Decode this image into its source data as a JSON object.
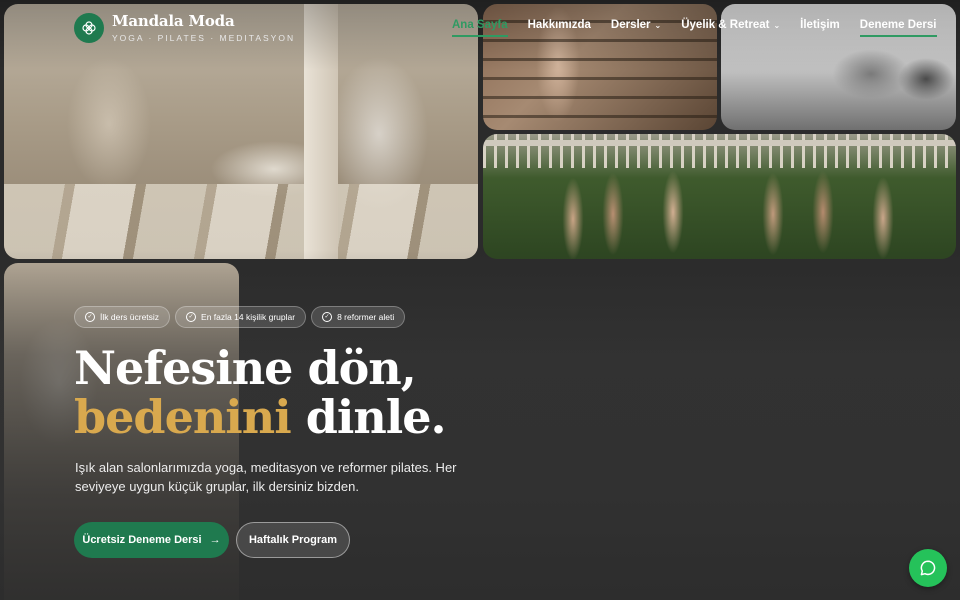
{
  "brand": {
    "name": "Mandala Moda",
    "tagline": "YOGA · PILATES · MEDITASYON",
    "logo_icon": "flower-icon",
    "accent_color": "#1f7a4f",
    "highlight_color": "#d9a94e"
  },
  "nav": {
    "items": [
      {
        "label": "Ana Sayfa",
        "active": true
      },
      {
        "label": "Hakkımızda"
      },
      {
        "label": "Dersler",
        "dropdown": true
      },
      {
        "label": "Üyelik & Retreat",
        "dropdown": true
      },
      {
        "label": "İletişim"
      }
    ],
    "cta_label": "Deneme Dersi"
  },
  "hero": {
    "badges": [
      {
        "icon": "check-circle-icon",
        "label": "İlk ders ücretsiz"
      },
      {
        "icon": "check-circle-icon",
        "label": "En fazla 14 kişilik gruplar"
      },
      {
        "icon": "check-circle-icon",
        "label": "8 reformer aleti"
      }
    ],
    "headline_line1": "Nefesine dön,",
    "headline_accent": "bedenini",
    "headline_rest": "dinle.",
    "subtext": "Işık alan salonlarımızda yoga, meditasyon ve reformer pilates. Her seviyeye uygun küçük gruplar, ilk dersiniz bizden.",
    "primary_button": "Ücretsiz Deneme Dersi",
    "secondary_button": "Haftalık Program"
  },
  "chat": {
    "icon": "chat-bubble-icon",
    "color": "#25c25a"
  }
}
